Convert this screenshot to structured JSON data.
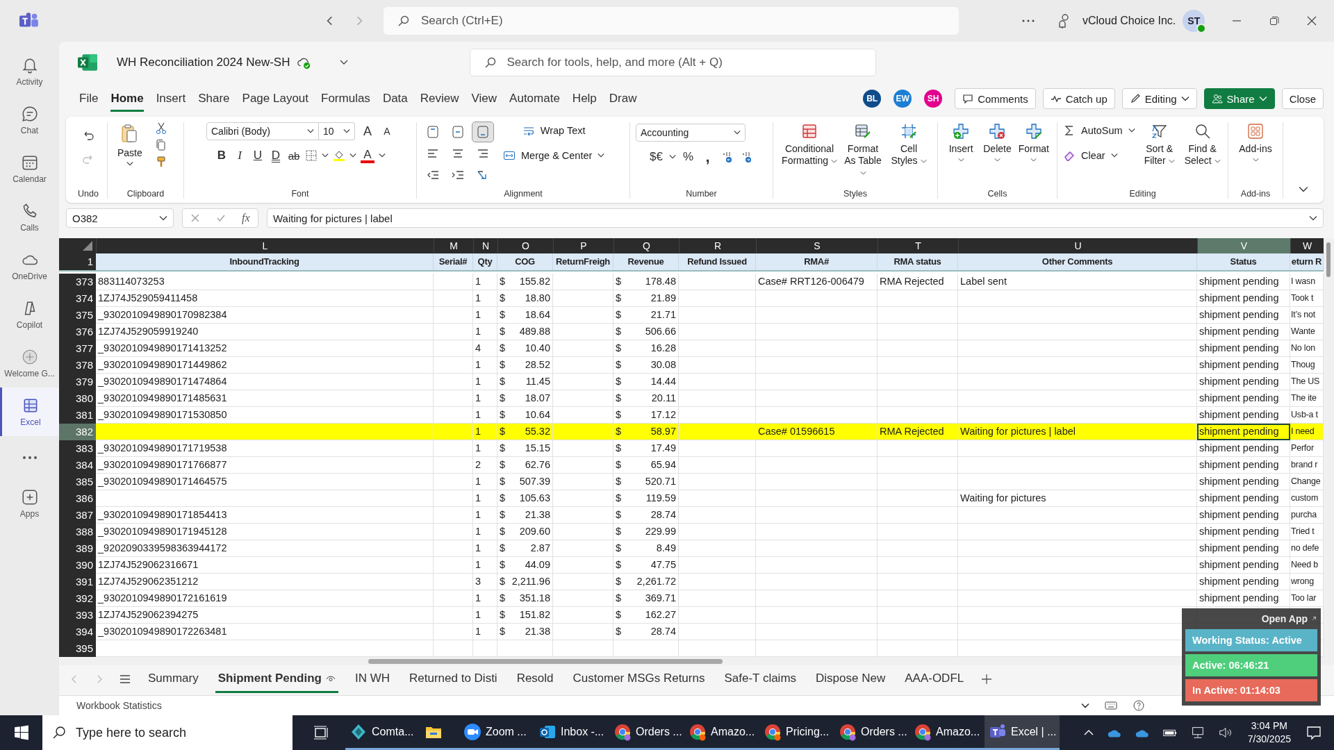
{
  "teams_bar": {
    "search_placeholder": "Search (Ctrl+E)",
    "org": "vCloud Choice Inc.",
    "avatar": "ST"
  },
  "rail": [
    {
      "label": "Activity",
      "selected": false
    },
    {
      "label": "Chat",
      "selected": false
    },
    {
      "label": "Calendar",
      "selected": false
    },
    {
      "label": "Calls",
      "selected": false
    },
    {
      "label": "OneDrive",
      "selected": false
    },
    {
      "label": "Copilot",
      "selected": false
    },
    {
      "label": "Welcome G...",
      "selected": false
    },
    {
      "label": "Excel",
      "selected": true
    },
    {
      "label": "Apps",
      "selected": false
    }
  ],
  "excel": {
    "title": "WH Reconciliation 2024 New-SH",
    "search_placeholder": "Search for tools, help, and more (Alt + Q)"
  },
  "menu_tabs": [
    {
      "label": "File",
      "selected": false
    },
    {
      "label": "Home",
      "selected": true
    },
    {
      "label": "Insert",
      "selected": false
    },
    {
      "label": "Share",
      "selected": false
    },
    {
      "label": "Page Layout",
      "selected": false
    },
    {
      "label": "Formulas",
      "selected": false
    },
    {
      "label": "Data",
      "selected": false
    },
    {
      "label": "Review",
      "selected": false
    },
    {
      "label": "View",
      "selected": false
    },
    {
      "label": "Automate",
      "selected": false
    },
    {
      "label": "Help",
      "selected": false
    },
    {
      "label": "Draw",
      "selected": false
    }
  ],
  "collaborators": [
    {
      "initials": "BL",
      "color": "#0f4c8a"
    },
    {
      "initials": "EW",
      "color": "#1b7fd4"
    },
    {
      "initials": "SH",
      "color": "#e3008c"
    }
  ],
  "actions": [
    {
      "label": "Comments",
      "kind": "outline"
    },
    {
      "label": "Catch up",
      "kind": "outline"
    },
    {
      "label": "Editing",
      "kind": "menu"
    },
    {
      "label": "Share",
      "kind": "primary"
    },
    {
      "label": "Close",
      "kind": "plain"
    }
  ],
  "ribbon": {
    "undo": {
      "label": "Undo"
    },
    "clipboard": {
      "label": "Clipboard",
      "paste": "Paste"
    },
    "font": {
      "label": "Font",
      "family": "Calibri (Body)",
      "size": "10",
      "grow": "A",
      "shrink": "A",
      "bold": "B",
      "italic": "I",
      "underline": "U",
      "double_underline": "D",
      "strike": "ab",
      "font_color": "A"
    },
    "alignment": {
      "label": "Alignment",
      "wrap": "Wrap Text",
      "merge": "Merge & Center",
      "vertical": [
        {
          "selected": false
        },
        {
          "selected": false
        },
        {
          "selected": true
        }
      ]
    },
    "number": {
      "label": "Number",
      "format": "Accounting",
      "currency": "$€",
      "percent": "%",
      "comma": ","
    },
    "styles": {
      "label": "Styles",
      "items": [
        "Conditional Formatting",
        "Format As Table",
        "Cell Styles"
      ]
    },
    "cells": {
      "label": "Cells",
      "items": [
        "Insert",
        "Delete",
        "Format"
      ]
    },
    "editing": {
      "label": "Editing",
      "autosum": "AutoSum",
      "clear": "Clear",
      "sort": "Sort & Filter",
      "find": "Find & Select"
    },
    "addins": {
      "label": "Add-ins",
      "button": "Add-ins"
    }
  },
  "formula_bar": {
    "name_box": "O382",
    "fx": "fx",
    "value": "Waiting for pictures | label"
  },
  "sheet": {
    "columns": [
      {
        "letter": "L",
        "heading": "InboundTracking",
        "selected": false
      },
      {
        "letter": "M",
        "heading": "Serial#",
        "selected": false
      },
      {
        "letter": "N",
        "heading": "Qty",
        "selected": false
      },
      {
        "letter": "O",
        "heading": "COG",
        "selected": false
      },
      {
        "letter": "P",
        "heading": "ReturnFreigh",
        "selected": false
      },
      {
        "letter": "Q",
        "heading": "Revenue",
        "selected": false
      },
      {
        "letter": "R",
        "heading": "Refund Issued",
        "selected": false
      },
      {
        "letter": "S",
        "heading": "RMA#",
        "selected": false
      },
      {
        "letter": "T",
        "heading": "RMA status",
        "selected": false
      },
      {
        "letter": "U",
        "heading": "Other Comments",
        "selected": false
      },
      {
        "letter": "V",
        "heading": "Status",
        "selected": true
      },
      {
        "letter": "W",
        "heading": "eturn R",
        "selected": false
      }
    ],
    "header_row": "1",
    "rows": [
      {
        "n": "373",
        "tracking": "883114073253",
        "qty": "1",
        "cog": {
          "symbol": "$",
          "amount": "155.82"
        },
        "revenue": {
          "symbol": "$",
          "amount": "178.48"
        },
        "rma": "Case# RRT126-006479",
        "rma_status": "RMA Rejected",
        "comments": "Label sent",
        "status": "shipment pending",
        "w": "I wasn",
        "highlight": false,
        "selected": false
      },
      {
        "n": "374",
        "tracking": "1ZJ74J529059411458",
        "qty": "1",
        "cog": {
          "symbol": "$",
          "amount": "18.80"
        },
        "revenue": {
          "symbol": "$",
          "amount": "21.89"
        },
        "status": "shipment pending",
        "w": "Took t",
        "highlight": false,
        "selected": false
      },
      {
        "n": "375",
        "tracking": "_9302010949890170982384",
        "qty": "1",
        "cog": {
          "symbol": "$",
          "amount": "18.64"
        },
        "revenue": {
          "symbol": "$",
          "amount": "21.71"
        },
        "status": "shipment pending",
        "w": "It’s not",
        "highlight": false,
        "selected": false
      },
      {
        "n": "376",
        "tracking": "1ZJ74J529059919240",
        "qty": "1",
        "cog": {
          "symbol": "$",
          "amount": "489.88"
        },
        "revenue": {
          "symbol": "$",
          "amount": "506.66"
        },
        "status": "shipment pending",
        "w": "Wante",
        "highlight": false,
        "selected": false
      },
      {
        "n": "377",
        "tracking": "_9302010949890171413252",
        "qty": "4",
        "cog": {
          "symbol": "$",
          "amount": "10.40"
        },
        "revenue": {
          "symbol": "$",
          "amount": "16.28"
        },
        "status": "shipment pending",
        "w": "No lon",
        "highlight": false,
        "selected": false
      },
      {
        "n": "378",
        "tracking": "_9302010949890171449862",
        "qty": "1",
        "cog": {
          "symbol": "$",
          "amount": "28.52"
        },
        "revenue": {
          "symbol": "$",
          "amount": "30.08"
        },
        "status": "shipment pending",
        "w": "Thoug",
        "highlight": false,
        "selected": false
      },
      {
        "n": "379",
        "tracking": "_9302010949890171474864",
        "qty": "1",
        "cog": {
          "symbol": "$",
          "amount": "11.45"
        },
        "revenue": {
          "symbol": "$",
          "amount": "14.44"
        },
        "status": "shipment pending",
        "w": "The US",
        "highlight": false,
        "selected": false
      },
      {
        "n": "380",
        "tracking": "_9302010949890171485631",
        "qty": "1",
        "cog": {
          "symbol": "$",
          "amount": "18.07"
        },
        "revenue": {
          "symbol": "$",
          "amount": "20.11"
        },
        "status": "shipment pending",
        "w": "The ite",
        "highlight": false,
        "selected": false
      },
      {
        "n": "381",
        "tracking": "_9302010949890171530850",
        "qty": "1",
        "cog": {
          "symbol": "$",
          "amount": "10.64"
        },
        "revenue": {
          "symbol": "$",
          "amount": "17.12"
        },
        "status": "shipment pending",
        "w": "Usb-a t",
        "highlight": false,
        "selected": false
      },
      {
        "n": "382",
        "qty": "1",
        "cog": {
          "symbol": "$",
          "amount": "55.32"
        },
        "revenue": {
          "symbol": "$",
          "amount": "58.97"
        },
        "rma": "Case# 01596615",
        "rma_status": "RMA Rejected",
        "comments": "Waiting for pictures | label",
        "status": "shipment pending",
        "w": "I need",
        "highlight": true,
        "selected": true
      },
      {
        "n": "383",
        "tracking": "_9302010949890171719538",
        "qty": "1",
        "cog": {
          "symbol": "$",
          "amount": "15.15"
        },
        "revenue": {
          "symbol": "$",
          "amount": "17.49"
        },
        "status": "shipment pending",
        "w": "Perfor",
        "highlight": false,
        "selected": false
      },
      {
        "n": "384",
        "tracking": "_9302010949890171766877",
        "qty": "2",
        "cog": {
          "symbol": "$",
          "amount": "62.76"
        },
        "revenue": {
          "symbol": "$",
          "amount": "65.94"
        },
        "status": "shipment pending",
        "w": "brand r",
        "highlight": false,
        "selected": false
      },
      {
        "n": "385",
        "tracking": "_9302010949890171464575",
        "qty": "1",
        "cog": {
          "symbol": "$",
          "amount": "507.39"
        },
        "revenue": {
          "symbol": "$",
          "amount": "520.71"
        },
        "status": "shipment pending",
        "w": "Change",
        "highlight": false,
        "selected": false
      },
      {
        "n": "386",
        "qty": "1",
        "cog": {
          "symbol": "$",
          "amount": "105.63"
        },
        "revenue": {
          "symbol": "$",
          "amount": "119.59"
        },
        "comments": "Waiting for pictures",
        "status": "shipment pending",
        "w": "custom",
        "highlight": false,
        "selected": false
      },
      {
        "n": "387",
        "tracking": "_9302010949890171854413",
        "qty": "1",
        "cog": {
          "symbol": "$",
          "amount": "21.38"
        },
        "revenue": {
          "symbol": "$",
          "amount": "28.74"
        },
        "status": "shipment pending",
        "w": "purcha",
        "highlight": false,
        "selected": false
      },
      {
        "n": "388",
        "tracking": "_9302010949890171945128",
        "qty": "1",
        "cog": {
          "symbol": "$",
          "amount": "209.60"
        },
        "revenue": {
          "symbol": "$",
          "amount": "229.99"
        },
        "status": "shipment pending",
        "w": "Tried t",
        "highlight": false,
        "selected": false
      },
      {
        "n": "389",
        "tracking": "_9202090339598363944172",
        "qty": "1",
        "cog": {
          "symbol": "$",
          "amount": "2.87"
        },
        "revenue": {
          "symbol": "$",
          "amount": "8.49"
        },
        "status": "shipment pending",
        "w": "no defe",
        "highlight": false,
        "selected": false
      },
      {
        "n": "390",
        "tracking": "1ZJ74J529062316671",
        "qty": "1",
        "cog": {
          "symbol": "$",
          "amount": "44.09"
        },
        "revenue": {
          "symbol": "$",
          "amount": "47.75"
        },
        "status": "shipment pending",
        "w": "Need b",
        "highlight": false,
        "selected": false
      },
      {
        "n": "391",
        "tracking": "1ZJ74J529062351212",
        "qty": "3",
        "cog": {
          "symbol": "$",
          "amount": "2,211.96"
        },
        "revenue": {
          "symbol": "$",
          "amount": "2,261.72"
        },
        "status": "shipment pending",
        "w": "wrong",
        "highlight": false,
        "selected": false
      },
      {
        "n": "392",
        "tracking": "_9302010949890172161619",
        "qty": "1",
        "cog": {
          "symbol": "$",
          "amount": "351.18"
        },
        "revenue": {
          "symbol": "$",
          "amount": "369.71"
        },
        "status": "shipment pending",
        "w": "Too lar",
        "highlight": false,
        "selected": false
      },
      {
        "n": "393",
        "tracking": "1ZJ74J529062394275",
        "qty": "1",
        "cog": {
          "symbol": "$",
          "amount": "151.82"
        },
        "revenue": {
          "symbol": "$",
          "amount": "162.27"
        },
        "highlight": false,
        "selected": false
      },
      {
        "n": "394",
        "tracking": "_9302010949890172263481",
        "qty": "1",
        "cog": {
          "symbol": "$",
          "amount": "21.38"
        },
        "revenue": {
          "symbol": "$",
          "amount": "28.74"
        },
        "highlight": false,
        "selected": false
      },
      {
        "n": "395",
        "highlight": false,
        "selected": false
      }
    ]
  },
  "sheet_tabs": [
    {
      "label": "Summary",
      "selected": false
    },
    {
      "label": "Shipment Pending",
      "selected": true
    },
    {
      "label": "IN WH",
      "selected": false
    },
    {
      "label": "Returned to Disti",
      "selected": false
    },
    {
      "label": "Resold",
      "selected": false
    },
    {
      "label": "Customer MSGs Returns",
      "selected": false
    },
    {
      "label": "Safe-T claims",
      "selected": false
    },
    {
      "label": "Dispose New",
      "selected": false
    },
    {
      "label": "AAA-ODFL",
      "selected": false
    }
  ],
  "status_bar": {
    "label": "Workbook Statistics"
  },
  "widget": {
    "open_app": "Open App",
    "working_status": "Working Status: Active",
    "active": "Active: 06:46:21",
    "inactive": "In Active: 01:14:03"
  },
  "taskbar": {
    "search_placeholder": "Type here to search",
    "apps": [
      {
        "label": "Comta...",
        "selected": false
      },
      {
        "selected": false
      },
      {
        "label": "Zoom ...",
        "selected": false
      },
      {
        "label": "Inbox -...",
        "selected": false
      },
      {
        "label": "Orders ...",
        "selected": false
      },
      {
        "label": "Amazo...",
        "selected": false
      },
      {
        "label": "Pricing...",
        "selected": false
      },
      {
        "label": "Orders ...",
        "selected": false
      },
      {
        "label": "Amazo...",
        "selected": false
      },
      {
        "label": "Excel | ...",
        "selected": true
      }
    ],
    "time": "3:04 PM",
    "date": "7/30/2025"
  }
}
